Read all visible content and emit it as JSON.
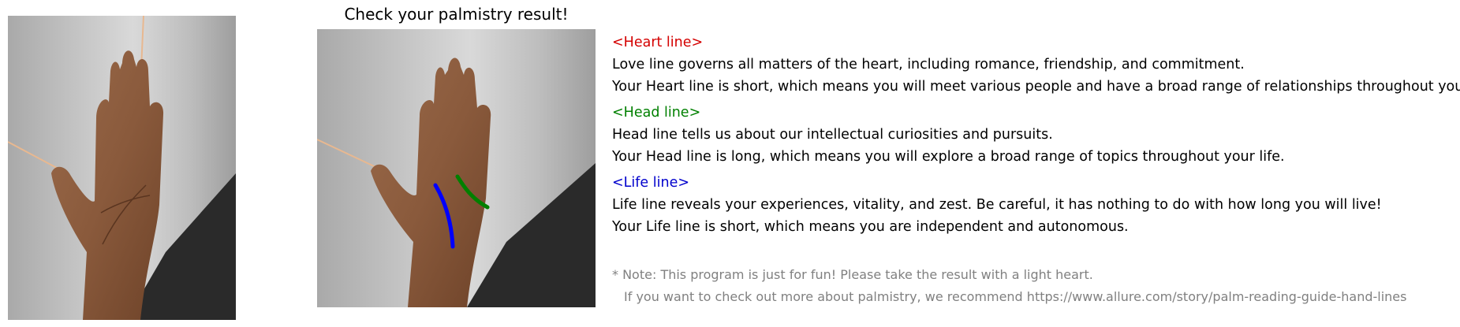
{
  "result_title": "Check your palmistry result!",
  "lines": [
    {
      "key": "heart",
      "heading": "<Heart line>",
      "color": "#d40000",
      "description": "Love line governs all matters of the heart, including romance, friendship, and commitment.",
      "result": "Your Heart line is short, which means you will meet various people and have a broad range of relationships throughout your life."
    },
    {
      "key": "head",
      "heading": "<Head line>",
      "color": "#008000",
      "description": "Head line tells us about our intellectual curiosities and pursuits.",
      "result": "Your Head line is long, which means you will explore a broad range of topics throughout your life."
    },
    {
      "key": "life",
      "heading": "<Life line>",
      "color": "#0000cc",
      "description": "Life line reveals your experiences, vitality, and zest. Be careful, it has nothing to do with how long you will live!",
      "result": "Your Life line is short, which means you are independent and autonomous."
    }
  ],
  "note": {
    "line1": "* Note: This program is just for fun! Please take the result with a light heart.",
    "line2": "If you want to check out more about palmistry, we recommend https://www.allure.com/story/palm-reading-guide-hand-lines",
    "color": "#808080"
  },
  "overlay_colors": {
    "head_line": "#008000",
    "life_line": "#0000ff"
  }
}
